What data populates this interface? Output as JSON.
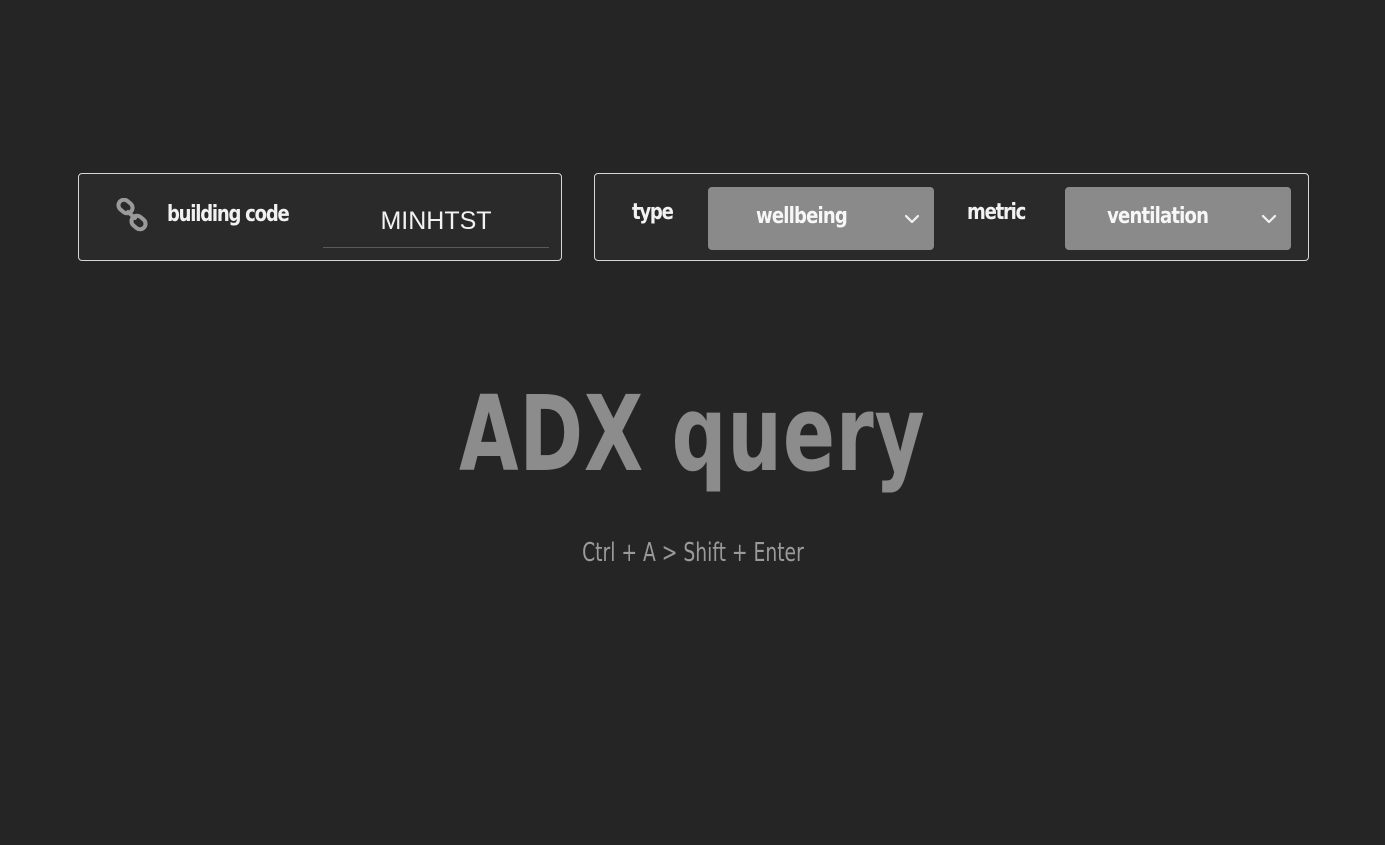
{
  "building": {
    "icon": "link-icon",
    "label": "building code",
    "value": "MINHTST"
  },
  "filters": {
    "type_label": "type",
    "type_value": "wellbeing",
    "metric_label": "metric",
    "metric_value": "ventilation"
  },
  "hero": {
    "title": "ADX query",
    "shortcut": "Ctrl + A  >  Shift + Enter"
  },
  "colors": {
    "background": "#252525",
    "select_bg": "#8a8a8a",
    "title": "#8c8c8c"
  }
}
